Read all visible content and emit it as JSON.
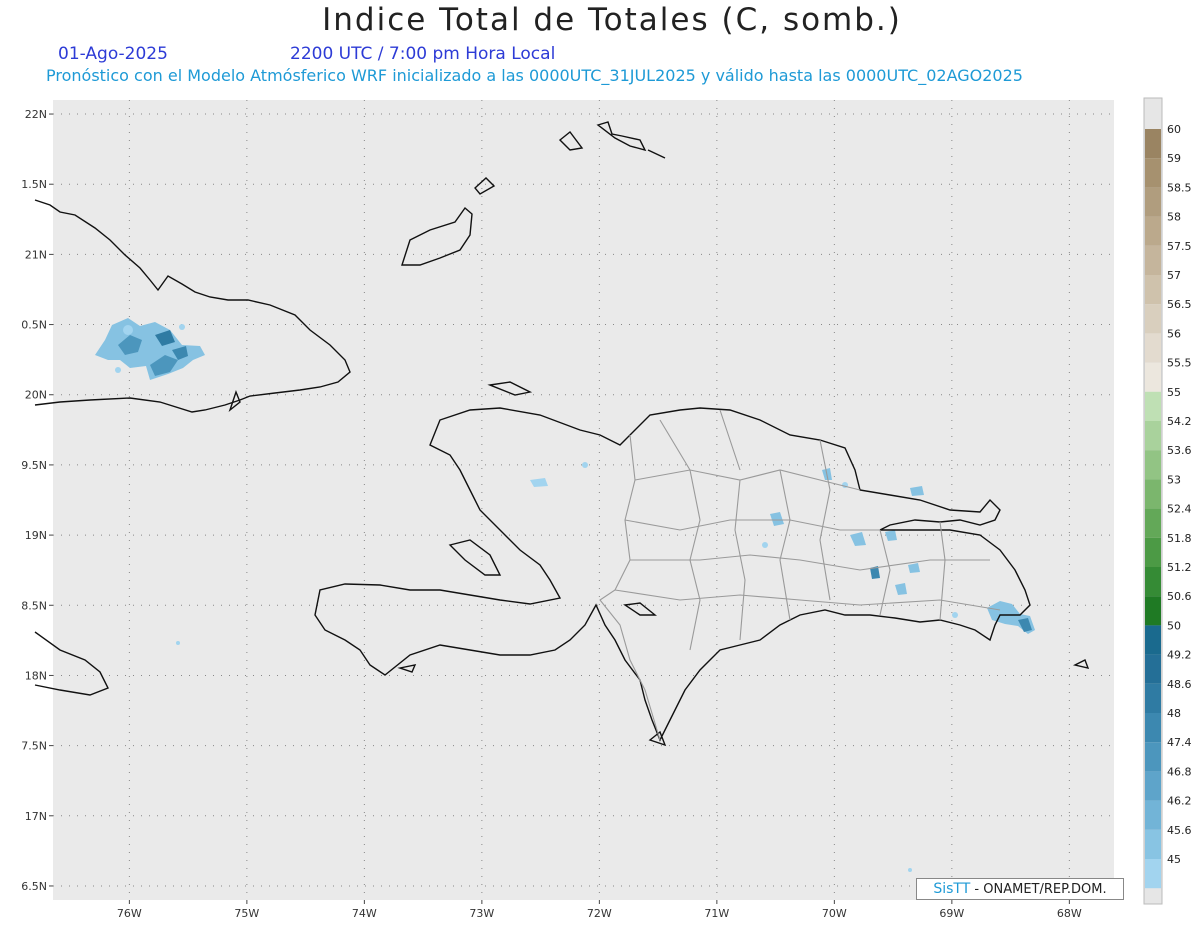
{
  "header": {
    "title": "Indice Total de Totales (C, somb.)",
    "date": "01-Ago-2025",
    "time": "2200 UTC / 7:00 pm Hora Local",
    "description": "Pronóstico con el Modelo Atmósferico WRF inicializado a las 0000UTC_31JUL2025 y válido hasta las  0000UTC_02AGO2025"
  },
  "map": {
    "lon_range": [
      -76.65,
      -67.62
    ],
    "lat_range": [
      16.4,
      22.1
    ],
    "lat_labels": [
      "22N",
      "1.5N",
      "21N",
      "0.5N",
      "20N",
      "9.5N",
      "19N",
      "8.5N",
      "18N",
      "7.5N",
      "17N",
      "6.5N"
    ],
    "lat_values": [
      22,
      21.5,
      21,
      20.5,
      20,
      19.5,
      19,
      18.5,
      18,
      17.5,
      17,
      16.5
    ],
    "lon_labels": [
      "76W",
      "75W",
      "74W",
      "73W",
      "72W",
      "71W",
      "70W",
      "69W",
      "68W"
    ],
    "lon_values": [
      -76,
      -75,
      -74,
      -73,
      -72,
      -71,
      -70,
      -69,
      -68
    ],
    "background_color": "#eaeaea",
    "coast_color": "#111111",
    "border_color": "#9a9a9a"
  },
  "colorbar": {
    "labels": [
      "60",
      "59",
      "58.5",
      "58",
      "57.5",
      "57",
      "56.5",
      "56",
      "55.5",
      "55",
      "54.2",
      "53.6",
      "53",
      "52.4",
      "51.8",
      "51.2",
      "50.6",
      "50",
      "49.2",
      "48.6",
      "48",
      "47.4",
      "46.8",
      "46.2",
      "45.6",
      "45"
    ],
    "colors": [
      "#9a8462",
      "#a6916f",
      "#b09d7e",
      "#bba98c",
      "#c5b59c",
      "#cfc2ac",
      "#d9cfbe",
      "#e3dbcf",
      "#ece7de",
      "#bfe0b4",
      "#a9d29c",
      "#92c484",
      "#7bb66d",
      "#63a858",
      "#4c9a45",
      "#358b35",
      "#1f7a24",
      "#1a6a8e",
      "#246f97",
      "#2f7ba3",
      "#3c88b0",
      "#4c96bd",
      "#5ea4ca",
      "#72b4d7",
      "#88c4e3",
      "#a2d4ef"
    ]
  },
  "credit": {
    "logo": "SisTT",
    "text": " - ONAMET/REP.DOM."
  }
}
